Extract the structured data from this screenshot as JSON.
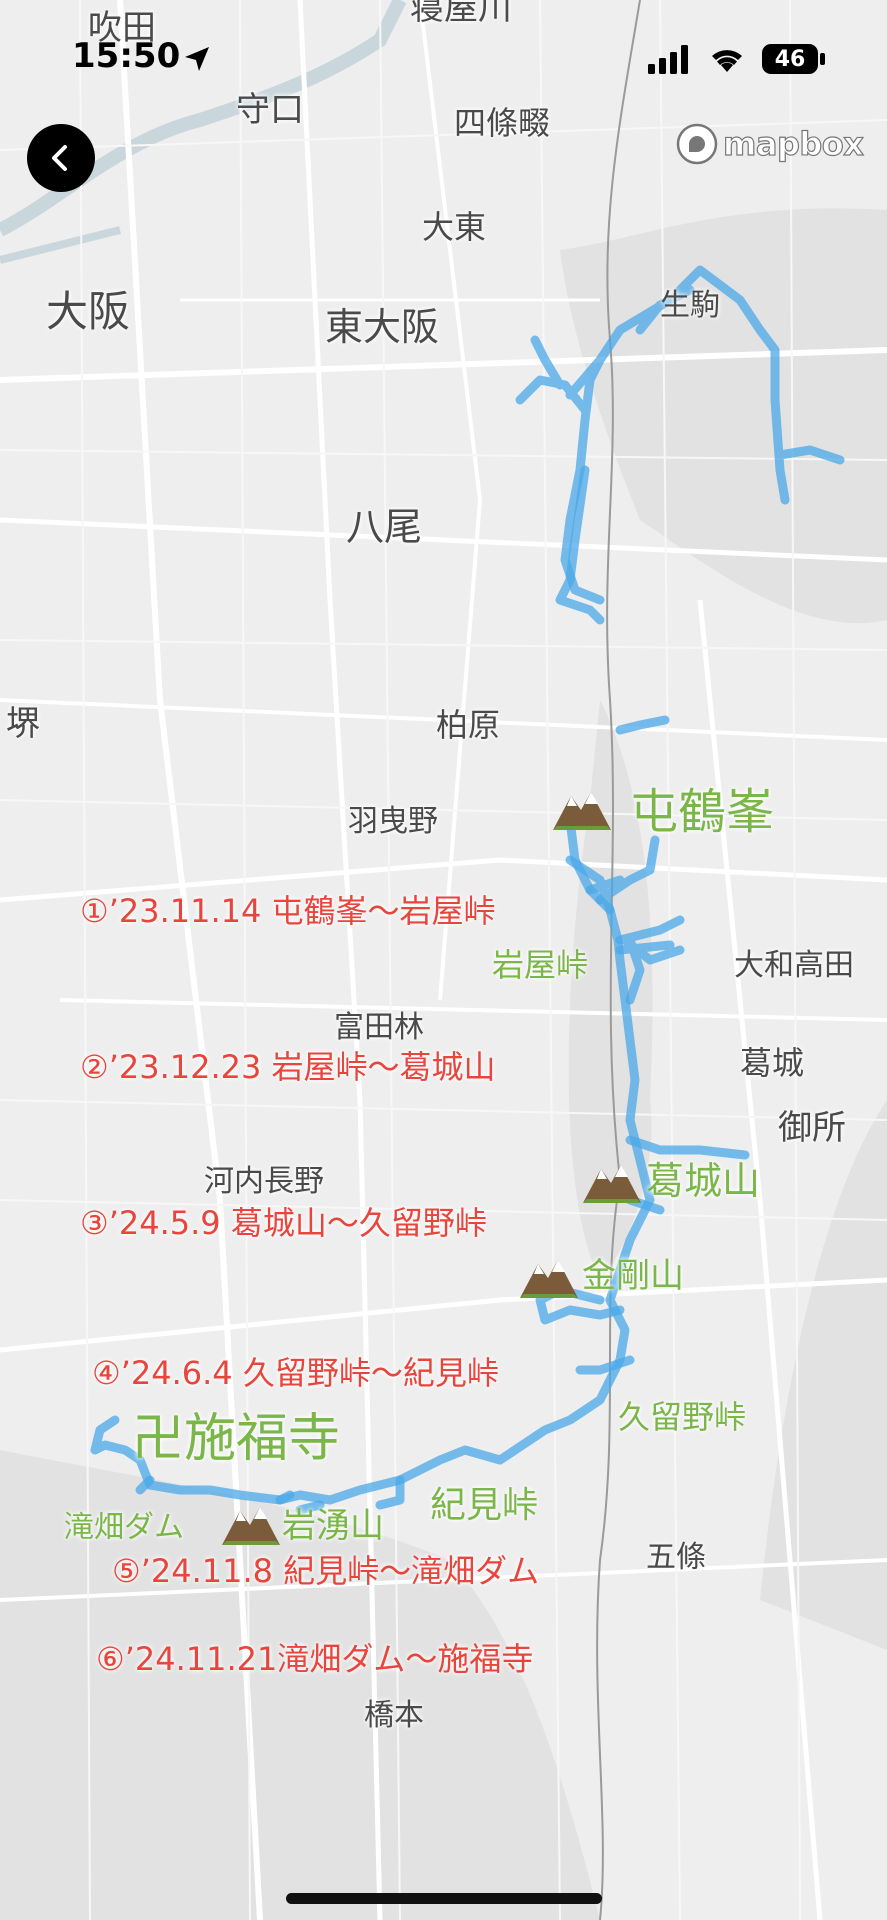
{
  "status_bar": {
    "time": "15:50",
    "battery": "46"
  },
  "map": {
    "attribution": "mapbox",
    "cities": {
      "suita": "吹田",
      "neyagawa_cut": "寝屋川",
      "moriguchi": "守口",
      "shijonawate": "四條畷",
      "daito": "大東",
      "osaka": "大阪",
      "higashiosaka": "東大阪",
      "ikoma": "生駒",
      "yao": "八尾",
      "sakai": "堺",
      "kashiwara": "柏原",
      "habikino": "羽曳野",
      "yamatotakada": "大和高田",
      "tondabayashi": "富田林",
      "katsuragi": "葛城",
      "gose": "御所",
      "kawachinagano": "河内長野",
      "gojo": "五條",
      "hashimoto": "橋本"
    },
    "places": {
      "donzurubo": "屯鶴峯",
      "iwaya_pass": "岩屋峠",
      "mt_katsuragi": "葛城山",
      "mt_kongo": "金剛山",
      "kurumino_pass": "久留野峠",
      "sefukuji": "卍施福寺",
      "kimi_pass": "紀見峠",
      "mt_iwawaki": "岩湧山",
      "takihata_dam": "滝畑ダム"
    },
    "route_color": "#4aa8e8",
    "place_label_color": "#7ab648",
    "annotation_color": "#e8453c"
  },
  "annotations": [
    "①’23.11.14 屯鶴峯～岩屋峠",
    "②’23.12.23 岩屋峠～葛城山",
    "③’24.5.9 葛城山～久留野峠",
    "④’24.6.4 久留野峠～紀見峠",
    "⑤’24.11.8 紀見峠～滝畑ダム",
    "⑥’24.11.21滝畑ダム～施福寺"
  ]
}
